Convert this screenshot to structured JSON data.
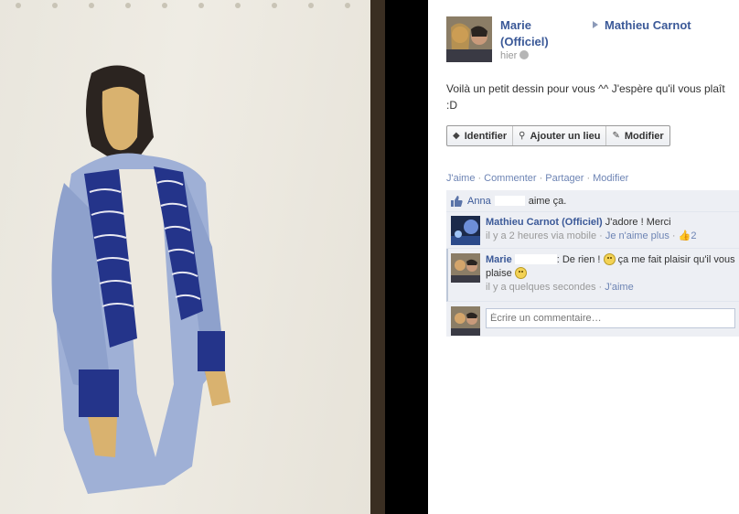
{
  "post": {
    "author": "Marie (Officiel)",
    "target": "Mathieu Carnot",
    "time": "hier",
    "caption": "Voilà un petit dessin pour vous ^^ J'espère qu'il vous plaît :D"
  },
  "photo_actions": {
    "tag": "Identifier",
    "location": "Ajouter un lieu",
    "edit": "Modifier"
  },
  "actions": {
    "like": "J'aime",
    "comment": "Commenter",
    "share": "Partager",
    "edit": "Modifier"
  },
  "likes": {
    "name": "Anna",
    "suffix": "aime ça."
  },
  "comments": [
    {
      "author": "Mathieu Carnot (Officiel)",
      "text": "J'adore ! Merci",
      "time": "il y a 2 heures via mobile",
      "unlike": "Je n'aime plus",
      "like_count": "2"
    },
    {
      "author": "Marie",
      "text_a": ": De rien !",
      "text_b": "ça me fait plaisir qu'il vous plaise",
      "time": "il y a quelques secondes",
      "like": "J'aime"
    }
  ],
  "composer": {
    "placeholder": "Écrire un commentaire…"
  },
  "icons": {
    "tag": "tag-icon",
    "location": "location-pin-icon",
    "edit": "pencil-icon",
    "like": "thumbs-up-icon",
    "globe": "globe-icon",
    "smiley": "smiley-icon"
  },
  "colors": {
    "link": "#3b5998",
    "ufi_bg": "#edeff4",
    "muted_link": "#6d84b4"
  }
}
